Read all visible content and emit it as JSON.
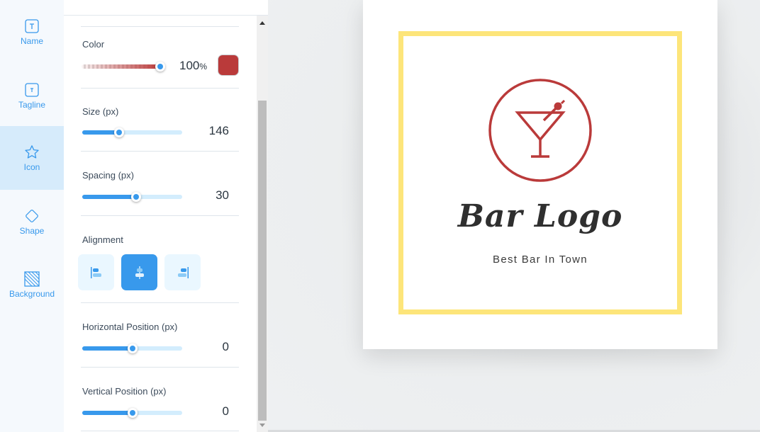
{
  "nav": {
    "items": [
      {
        "label": "Name",
        "icon": "text-box-icon",
        "active": false
      },
      {
        "label": "Tagline",
        "icon": "text-box-small-icon",
        "active": false
      },
      {
        "label": "Icon",
        "icon": "star-icon",
        "active": true
      },
      {
        "label": "Shape",
        "icon": "diamond-icon",
        "active": false
      },
      {
        "label": "Background",
        "icon": "hatched-square-icon",
        "active": false
      }
    ]
  },
  "panel": {
    "color": {
      "label": "Color",
      "opacity_value": "100",
      "opacity_unit": "%",
      "opacity_fraction": 1.0,
      "swatch": "#ba3a3a"
    },
    "size": {
      "label": "Size (px)",
      "value": "146",
      "fraction": 0.37
    },
    "spacing": {
      "label": "Spacing (px)",
      "value": "30",
      "fraction": 0.54
    },
    "alignment": {
      "label": "Alignment",
      "options": [
        "left",
        "center",
        "right"
      ],
      "selected": "center"
    },
    "horizontal": {
      "label": "Horizontal Position (px)",
      "value": "0",
      "fraction": 0.5
    },
    "vertical": {
      "label": "Vertical Position (px)",
      "value": "0",
      "fraction": 0.5
    }
  },
  "logo": {
    "title": "Bar Logo",
    "tagline": "Best Bar In Town",
    "icon": "cocktail-icon",
    "icon_color": "#ba3a3a",
    "frame_color": "#fde57a"
  }
}
